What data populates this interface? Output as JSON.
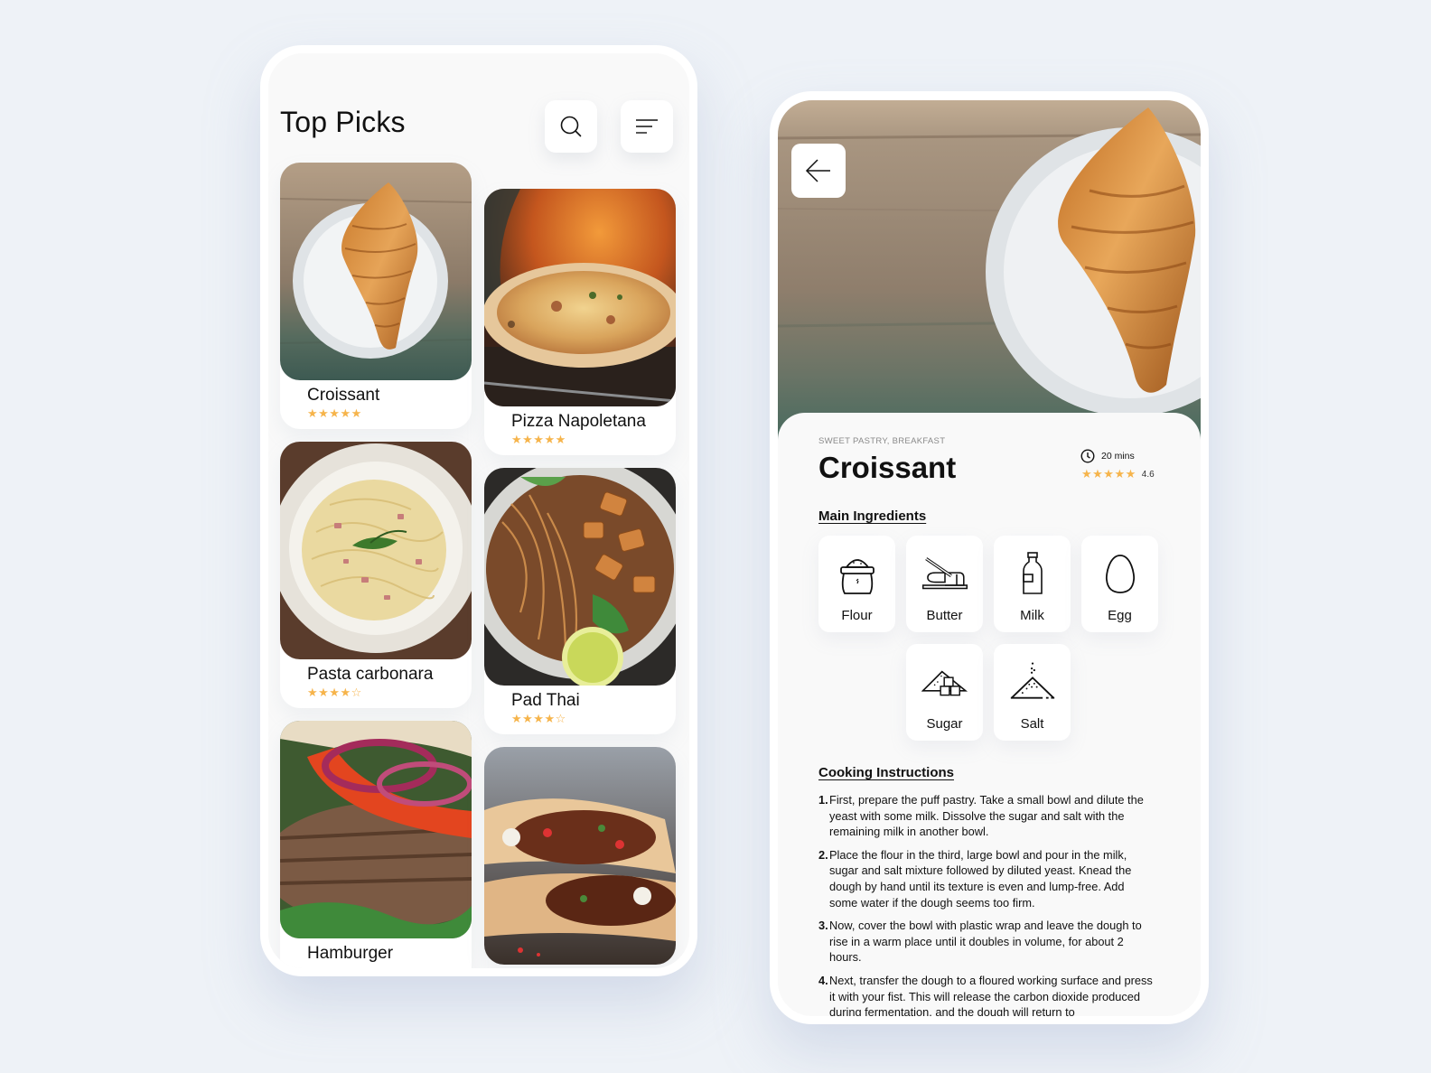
{
  "list_screen": {
    "title": "Top Picks",
    "search_icon": "search-icon",
    "filter_icon": "filter-lines-icon",
    "items": [
      {
        "name": "Croissant",
        "rating": 5,
        "max_rating": 5,
        "stars": "★★★★★"
      },
      {
        "name": "Pizza Napoletana",
        "rating": 5,
        "max_rating": 5,
        "stars": "★★★★★"
      },
      {
        "name": "Pasta carbonara",
        "rating": 4,
        "max_rating": 5,
        "stars": "★★★★☆"
      },
      {
        "name": "Pad Thai",
        "rating": 4,
        "max_rating": 5,
        "stars": "★★★★☆"
      },
      {
        "name": "Hamburger",
        "rating": null,
        "max_rating": 5,
        "stars": "· · · · ·"
      },
      {
        "name": "",
        "rating": null,
        "max_rating": 5,
        "stars": ""
      }
    ]
  },
  "detail_screen": {
    "back_icon": "arrow-left-icon",
    "category": "SWEET PASTRY, BREAKFAST",
    "title": "Croissant",
    "time_icon": "clock-icon",
    "time": "20 mins",
    "rating_stars": "★★★★★",
    "rating_value": "4.6",
    "ingredients_title": "Main Ingredients",
    "ingredients": [
      {
        "label": "Flour",
        "icon": "flour-sack-icon"
      },
      {
        "label": "Butter",
        "icon": "butter-icon"
      },
      {
        "label": "Milk",
        "icon": "milk-bottle-icon"
      },
      {
        "label": "Egg",
        "icon": "egg-icon"
      },
      {
        "label": "Sugar",
        "icon": "sugar-cubes-icon"
      },
      {
        "label": "Salt",
        "icon": "salt-pile-icon"
      }
    ],
    "instructions_title": "Cooking Instructions",
    "steps": [
      {
        "num": "1.",
        "text": "First, prepare the puff pastry. Take a small bowl and dilute the yeast with some milk. Dissolve the sugar and salt with the remaining milk in another bowl."
      },
      {
        "num": "2.",
        "text": "Place the flour in the third, large bowl and pour in the milk, sugar and salt mixture followed by diluted yeast. Knead the dough by hand until its texture is even and lump-free. Add some water if the dough seems too firm."
      },
      {
        "num": "3.",
        "text": "Now, cover the bowl with plastic wrap and leave the dough to rise in a warm place until it doubles in volume, for about 2 hours."
      },
      {
        "num": "4.",
        "text": "Next, transfer the dough to a floured working surface and press it with your fist. This will release the carbon dioxide produced during fermentation, and the dough will return to"
      }
    ]
  },
  "colors": {
    "background": "#eef2f7",
    "star": "#f6b44b",
    "screen": "#f9f9f9",
    "card": "#ffffff"
  }
}
